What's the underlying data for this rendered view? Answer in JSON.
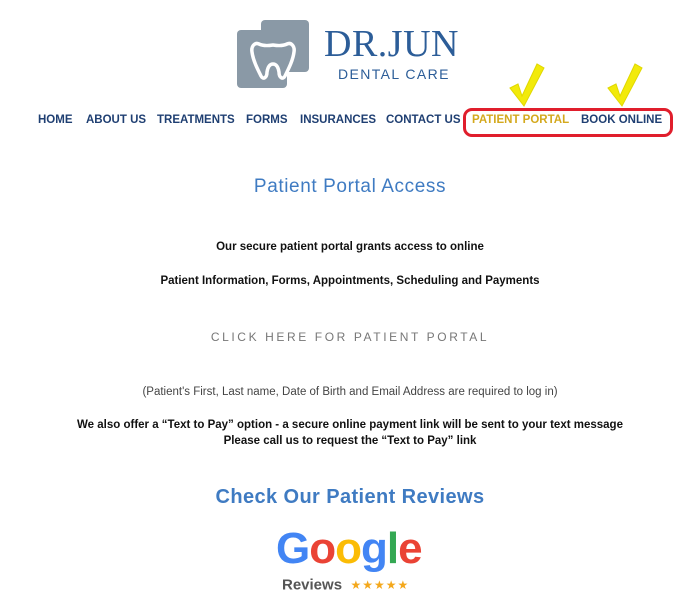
{
  "brand": {
    "name": "DR.JUN",
    "tagline": "DENTAL CARE",
    "colors": {
      "primary": "#2c5d98",
      "logo_bg": "#8a99a6"
    }
  },
  "nav": {
    "items": [
      {
        "label": "HOME"
      },
      {
        "label": "ABOUT US"
      },
      {
        "label": "TREATMENTS"
      },
      {
        "label": "FORMS"
      },
      {
        "label": "INSURANCES"
      },
      {
        "label": "CONTACT US"
      },
      {
        "label": "PATIENT PORTAL"
      },
      {
        "label": "BOOK ONLINE"
      }
    ],
    "colors": {
      "default": "#1f3f72",
      "active": "#d4a91e",
      "annotation_box": "#e01e2c",
      "annotation_check": "#f2ea0a"
    }
  },
  "content": {
    "title": "Patient Portal Access",
    "line1": "Our secure patient portal grants access to online",
    "line2": "Patient Information, Forms, Appointments, Scheduling and Payments",
    "cta": "CLICK HERE FOR PATIENT PORTAL",
    "note": "(Patient's First, Last name, Date of Birth and Email Address are required to log in)",
    "text_to_pay_1": "We also offer a “Text to Pay” option - a secure online payment link will be sent to your text message",
    "text_to_pay_2": "Please call us to request the “Text to Pay” link",
    "reviews_title": "Check Our Patient Reviews"
  },
  "google_badge": {
    "letters": [
      "G",
      "o",
      "o",
      "g",
      "l",
      "e"
    ],
    "label": "Reviews",
    "stars": "★★★★★"
  },
  "icons": [
    "tooth-logo-icon",
    "checkmark-icon",
    "star-icon"
  ]
}
